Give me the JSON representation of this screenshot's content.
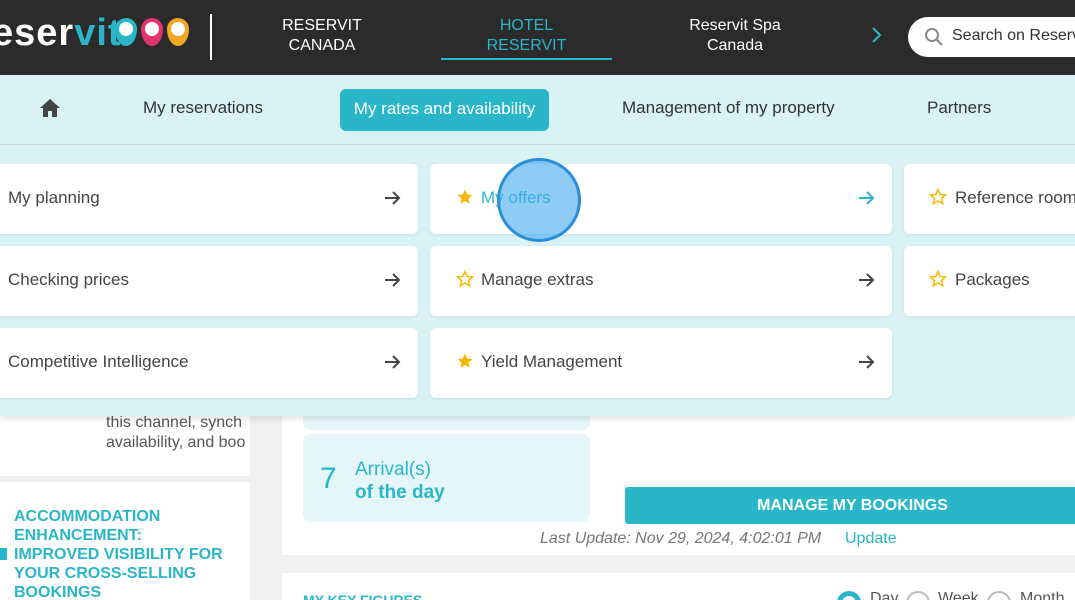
{
  "header": {
    "logo_main": "eser",
    "logo_accent": "vit",
    "tabs": [
      {
        "line1": "RESERVIT",
        "line2": "CANADA"
      },
      {
        "line1": "HOTEL",
        "line2": "RESERVIT"
      },
      {
        "line1": "Reservit Spa",
        "line2": "Canada"
      }
    ],
    "search_placeholder": "Search on Reservit",
    "colors": {
      "accent": "#29b6c8",
      "bar": "#2b2b2b",
      "pin1": "#29b6c8",
      "pin2": "#e4346f",
      "pin3": "#f5a623"
    }
  },
  "nav": {
    "items": [
      "My reservations",
      "My rates and availability",
      "Management of my property",
      "Partners"
    ]
  },
  "menu": {
    "col1": [
      "My planning",
      "Checking prices",
      "Competitive Intelligence"
    ],
    "col2": [
      "My offers",
      "Manage extras",
      "Yield Management"
    ],
    "col3": [
      "Reference room",
      "Packages"
    ]
  },
  "background": {
    "channel_text_1": "this channel, synch",
    "channel_text_2": "availability, and boo",
    "promo": "ACCOMMODATION ENHANCEMENT: IMPROVED VISIBILITY FOR YOUR CROSS-SELLING BOOKINGS",
    "arrival_count": "7",
    "arrival_label_1": "Arrival(s)",
    "arrival_label_2": "of the day",
    "manage_button": "MANAGE MY BOOKINGS",
    "last_update": "Last Update: Nov 29, 2024, 4:02:01 PM",
    "update_link": "Update",
    "key_figures": "MY KEY FIGURES",
    "period_options": [
      "Day",
      "Week",
      "Month"
    ]
  }
}
